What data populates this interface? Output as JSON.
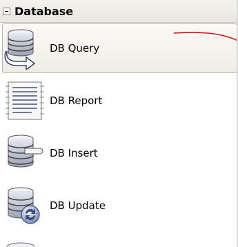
{
  "section": {
    "title": "Database",
    "collapse_glyph": "minus-box"
  },
  "items": [
    {
      "label": "DB Query",
      "icon": "db-query-icon",
      "selected": true
    },
    {
      "label": "DB Report",
      "icon": "db-report-icon",
      "selected": false
    },
    {
      "label": "DB Insert",
      "icon": "db-insert-icon",
      "selected": false
    },
    {
      "label": "DB Update",
      "icon": "db-update-icon",
      "selected": false
    }
  ],
  "colors": {
    "header_bg": "#e8e6de",
    "selected_bg": "#eeece5",
    "annotation_line": "#e01010",
    "db_blue": "#5a6f9c"
  }
}
